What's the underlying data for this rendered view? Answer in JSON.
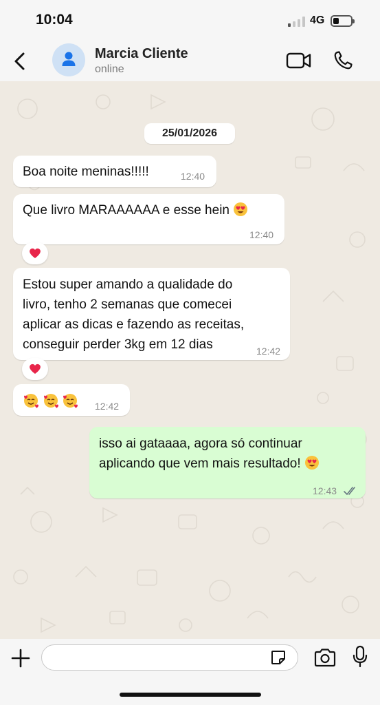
{
  "status_bar": {
    "time": "10:04",
    "network": "4G",
    "signal_bars_active": 1,
    "signal_bars_total": 4,
    "battery_level": 0.35
  },
  "header": {
    "contact_name": "Marcia Cliente",
    "contact_status": "online"
  },
  "chat": {
    "date_separator": "25/01/2026",
    "messages": [
      {
        "direction": "in",
        "text": "Boa noite meninas!!!!!",
        "time": "12:40"
      },
      {
        "direction": "in",
        "text": "Que livro MARAAAAAA e esse hein",
        "emoji": "smiling-face-with-heart-eyes",
        "time": "12:40",
        "reaction": "heart"
      },
      {
        "direction": "in",
        "text": "Estou super amando a qualidade do\nlivro, tenho 2 semanas que comecei\naplicar as dicas e fazendo as receitas,\nconseguir perder 3kg em 12 dias",
        "time": "12:42",
        "reaction": "heart"
      },
      {
        "direction": "in",
        "emojis": [
          "smiling-face-with-hearts",
          "smiling-face-with-hearts",
          "smiling-face-with-hearts"
        ],
        "time": "12:42"
      },
      {
        "direction": "out",
        "text": "isso ai gataaaa, agora só continuar\naplicando que vem mais resultado!",
        "emoji": "smiling-face-with-heart-eyes",
        "time": "12:43",
        "status": "read"
      }
    ]
  },
  "input_bar": {
    "placeholder": ""
  },
  "colors": {
    "chat_background": "#efeae2",
    "outgoing_bubble": "#d9fdd3",
    "incoming_bubble": "#ffffff",
    "read_ticks": "#667781",
    "heart": "#e8254a"
  },
  "icons": [
    "back-icon",
    "avatar-person-icon",
    "video-call-icon",
    "phone-icon",
    "plus-icon",
    "sticker-icon",
    "camera-icon",
    "mic-icon",
    "heart-icon",
    "double-check-icon"
  ]
}
